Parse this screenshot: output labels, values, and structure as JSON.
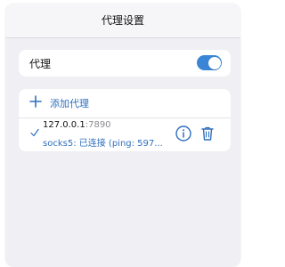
{
  "header": {
    "title": "代理设置"
  },
  "proxy": {
    "label": "代理",
    "enabled": true
  },
  "add_proxy": {
    "label": "添加代理"
  },
  "servers": [
    {
      "host": "127.0.0.1",
      "port": ":7890",
      "status": "socks5: 已连接 (ping: 597..."
    }
  ],
  "colors": {
    "accent": "#3a85d6",
    "link": "#2f6fbf",
    "background": "#efeff4",
    "card": "#ffffff"
  },
  "icons": {
    "add": "plus-icon",
    "selected": "check-icon",
    "info": "info-icon",
    "delete": "trash-icon"
  }
}
